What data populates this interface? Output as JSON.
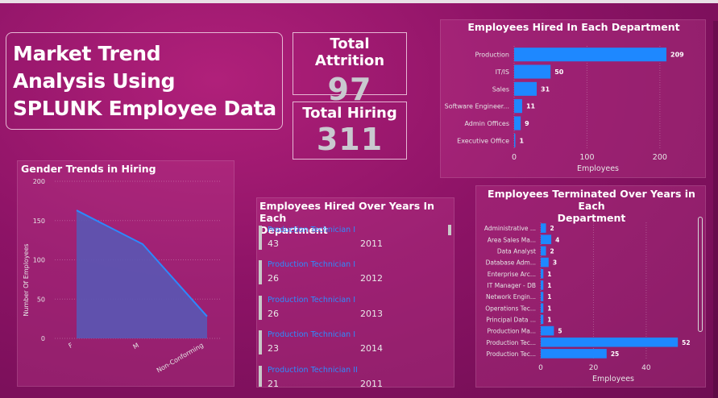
{
  "header": {
    "title_lines": [
      "Market Trend",
      "Analysis Using",
      "SPLUNK Employee Data"
    ]
  },
  "kpis": {
    "attrition": {
      "label": "Total Attrition",
      "value": "97"
    },
    "hiring": {
      "label": "Total Hiring",
      "value": "311"
    }
  },
  "colors": {
    "bar": "#1e88ff",
    "area_fill": "#5a57b4",
    "line": "#2b8aff",
    "link": "#2d8cff"
  },
  "hired_by_dept": {
    "title": "Employees Hired In Each Department",
    "xlabel": "Employees",
    "chart_data": {
      "type": "bar",
      "orientation": "horizontal",
      "categories": [
        "Production",
        "IT/IS",
        "Sales",
        "Software Engineer...",
        "Admin Offices",
        "Executive Office"
      ],
      "values": [
        209,
        50,
        31,
        11,
        9,
        1
      ],
      "xticks": [
        "0",
        "100",
        "200"
      ],
      "xlim": [
        0,
        230
      ]
    }
  },
  "gender_trends": {
    "title": "Gender Trends in Hiring",
    "ylabel": "Number Of Employees",
    "chart_data": {
      "type": "area",
      "categories": [
        "F",
        "M",
        "Non-Conforming"
      ],
      "values": [
        163,
        120,
        28
      ],
      "yticks": [
        "0",
        "50",
        "100",
        "150",
        "200"
      ],
      "ylim": [
        0,
        200
      ]
    }
  },
  "hired_over_years": {
    "title_lines": [
      "Employees Hired Over Years In Each",
      "Department"
    ],
    "rows": [
      {
        "name": "Production Technician I",
        "count": "43",
        "year": "2011"
      },
      {
        "name": "Production Technician I",
        "count": "26",
        "year": "2012"
      },
      {
        "name": "Production Technician I",
        "count": "26",
        "year": "2013"
      },
      {
        "name": "Production Technician I",
        "count": "23",
        "year": "2014"
      },
      {
        "name": "Production Technician II",
        "count": "21",
        "year": "2011"
      }
    ]
  },
  "terminated_over_years": {
    "title_lines": [
      "Employees Terminated Over Years in Each",
      "Department"
    ],
    "xlabel": "Employees",
    "chart_data": {
      "type": "bar",
      "orientation": "horizontal",
      "categories": [
        "Administrative ...",
        "Area Sales Ma...",
        "Data Analyst",
        "Database Adm...",
        "Enterprise Arc...",
        "IT Manager - DB",
        "Network Engin...",
        "Operations Tec...",
        "Principal Data ...",
        "Production Ma...",
        "Production Tec...",
        "Production Tec..."
      ],
      "values": [
        2,
        4,
        2,
        3,
        1,
        1,
        1,
        1,
        1,
        5,
        52,
        25
      ],
      "xticks": [
        "0",
        "20",
        "40"
      ],
      "xlim": [
        0,
        55
      ]
    }
  }
}
